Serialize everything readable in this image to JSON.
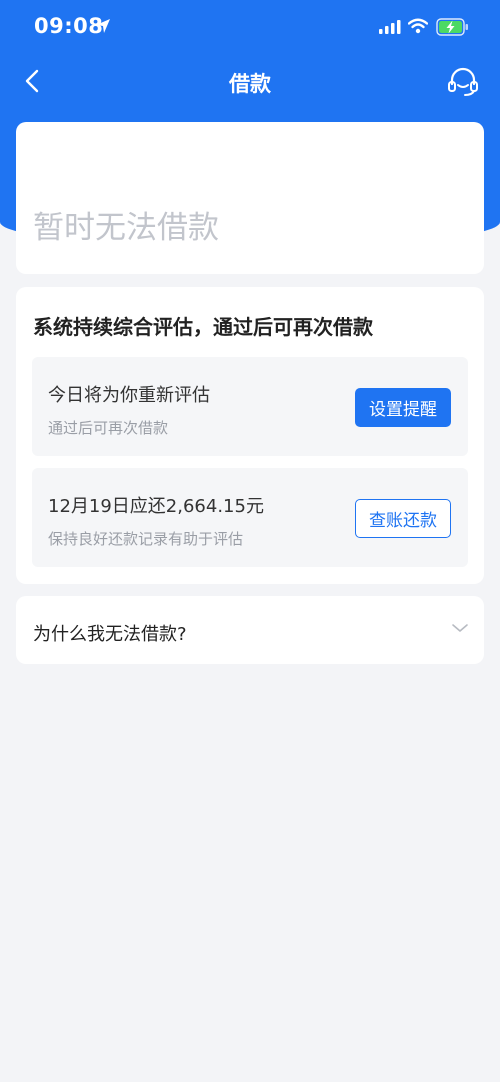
{
  "status_bar": {
    "time": "09:08"
  },
  "nav": {
    "title": "借款"
  },
  "status_card": {
    "message": "暂时无法借款"
  },
  "evaluation": {
    "heading": "系统持续综合评估，通过后可再次借款",
    "panels": [
      {
        "title": "今日将为你重新评估",
        "subtitle": "通过后可再次借款",
        "button": "设置提醒"
      },
      {
        "title": "12月19日应还2,664.15元",
        "subtitle": "保持良好还款记录有助于评估",
        "button": "查账还款"
      }
    ]
  },
  "faq": {
    "question": "为什么我无法借款?"
  },
  "colors": {
    "primary": "#1f74f2",
    "background": "#f3f4f7",
    "battery": "#4cd964"
  }
}
